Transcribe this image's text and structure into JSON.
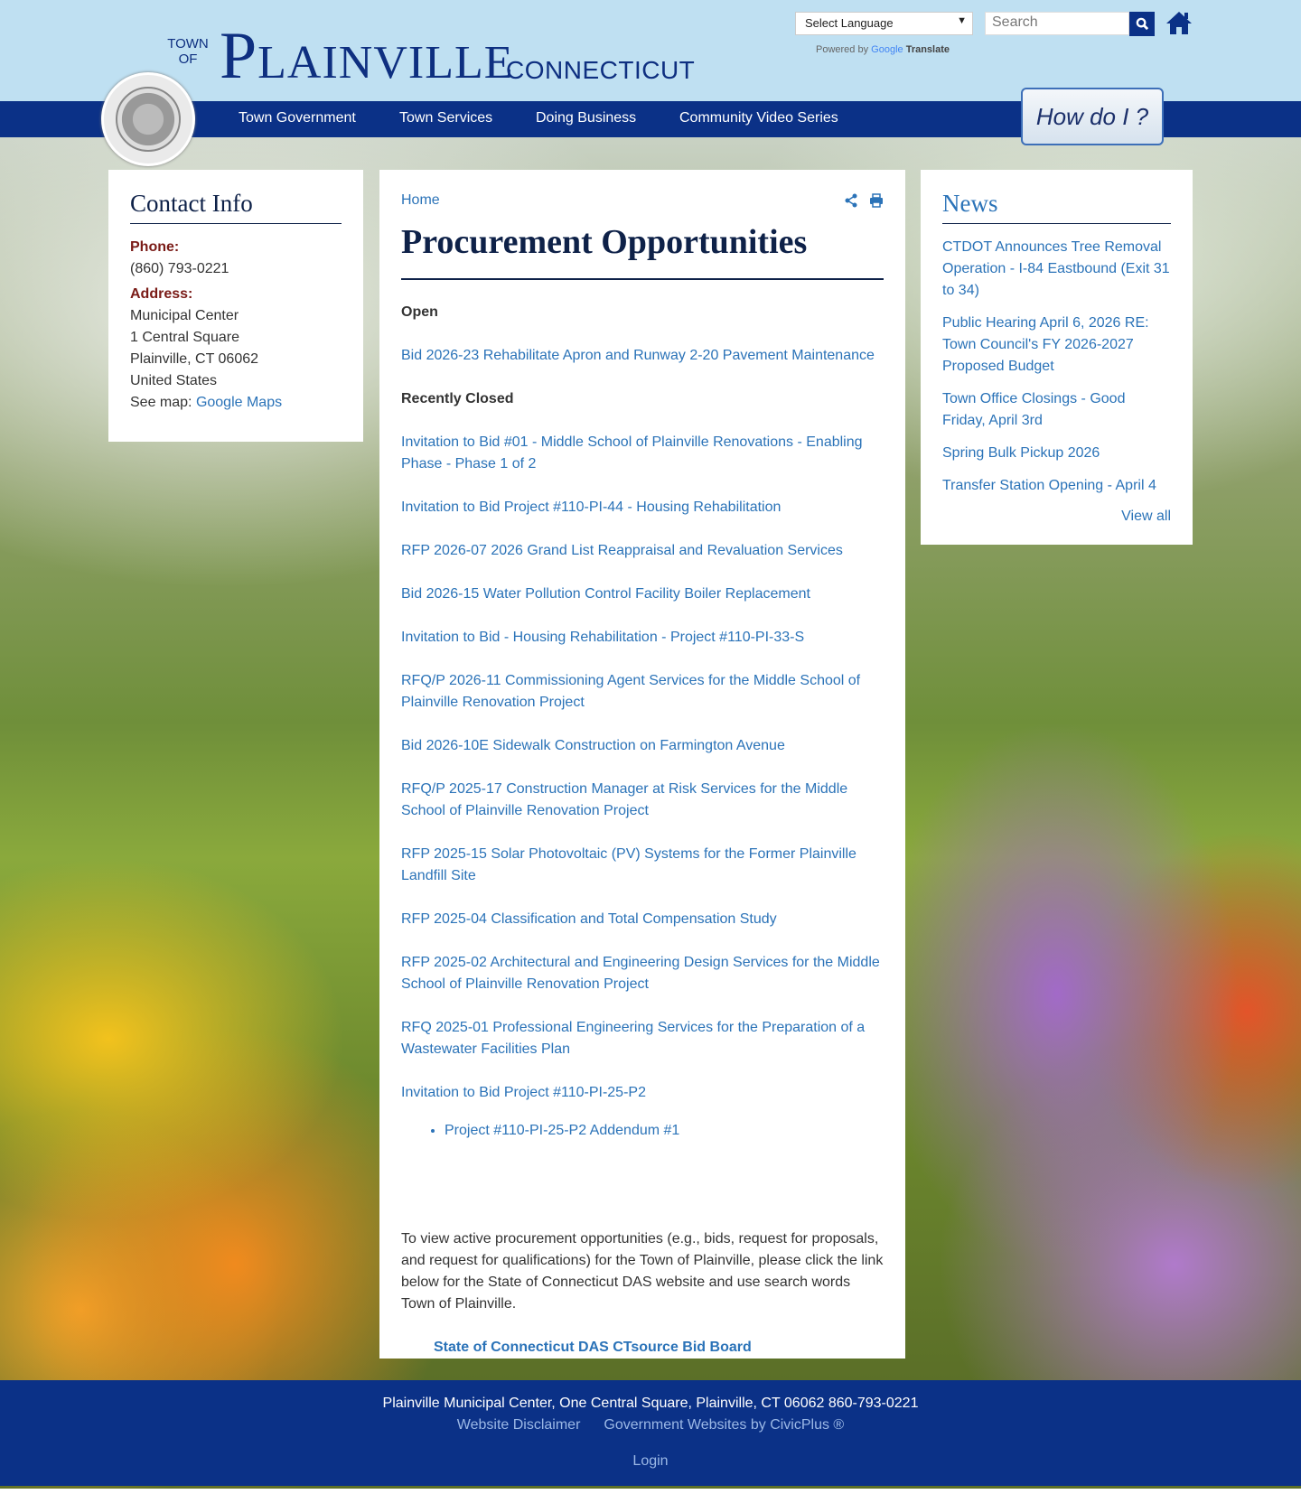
{
  "header": {
    "logo_town": "TOWN",
    "logo_of": "OF",
    "logo_main": "Plainville",
    "logo_state": "CONNECTICUT",
    "language_select": "Select Language",
    "powered_by": "Powered by",
    "google": "Google",
    "translate": "Translate",
    "search_placeholder": "Search",
    "how_do_i": "How do I ?"
  },
  "nav": [
    "Town Government",
    "Town Services",
    "Doing Business",
    "Community Video Series"
  ],
  "contact": {
    "title": "Contact Info",
    "phone_label": "Phone:",
    "phone": "(860) 793-0221",
    "address_label": "Address:",
    "address": [
      "Municipal Center",
      "1 Central Square",
      "Plainville, CT 06062",
      "United States"
    ],
    "map_label": "See map:",
    "map_link": "Google Maps"
  },
  "main": {
    "breadcrumb": "Home",
    "title": "Procurement Opportunities",
    "open_heading": "Open",
    "open": [
      "Bid 2026-23 Rehabilitate Apron and Runway 2-20 Pavement Maintenance"
    ],
    "closed_heading": "Recently Closed",
    "closed": [
      "Invitation to Bid #01 - Middle School of Plainville Renovations - Enabling Phase - Phase 1 of 2",
      "Invitation to Bid Project #110-PI-44 - Housing Rehabilitation",
      "RFP 2026-07 2026 Grand List Reappraisal and Revaluation Services",
      "Bid 2026-15 Water Pollution Control Facility Boiler Replacement",
      "Invitation to Bid - Housing Rehabilitation - Project #110-PI-33-S",
      "RFQ/P 2026-11 Commissioning Agent Services for the Middle School of Plainville Renovation Project",
      "Bid 2026-10E Sidewalk Construction on Farmington Avenue",
      "RFQ/P 2025-17 Construction Manager at Risk Services for the Middle School of Plainville Renovation Project",
      "RFP 2025-15 Solar Photovoltaic (PV) Systems for the Former Plainville Landfill Site",
      "RFP 2025-04 Classification and Total Compensation Study",
      "RFP 2025-02 Architectural and Engineering Design Services for the Middle School of Plainville Renovation Project",
      "RFQ 2025-01 Professional Engineering Services for the Preparation of a Wastewater Facilities Plan",
      "Invitation to Bid Project #110-PI-25-P2"
    ],
    "sub_item": "Project #110-PI-25-P2 Addendum #1",
    "note": "To view active procurement opportunities (e.g., bids, request for proposals, and request for qualifications) for the Town of Plainville, please click the link below for the State of Connecticut DAS website and use search words Town of Plainville.",
    "das_link": "State of Connecticut DAS CTsource Bid Board"
  },
  "news": {
    "title": "News",
    "items": [
      "CTDOT Announces Tree Removal Operation - I-84 Eastbound (Exit 31 to 34)",
      "Public Hearing April 6, 2026 RE: Town Council's FY 2026-2027 Proposed Budget",
      "Town Office Closings - Good Friday, April 3rd",
      "Spring Bulk Pickup 2026",
      "Transfer Station Opening - April 4"
    ],
    "view_all": "View all"
  },
  "footer": {
    "address": "Plainville Municipal Center, One Central Square, Plainville, CT 06062  860-793-0221",
    "disclaimer": "Website Disclaimer",
    "civicplus": "Government Websites by CivicPlus ®",
    "login": "Login"
  }
}
